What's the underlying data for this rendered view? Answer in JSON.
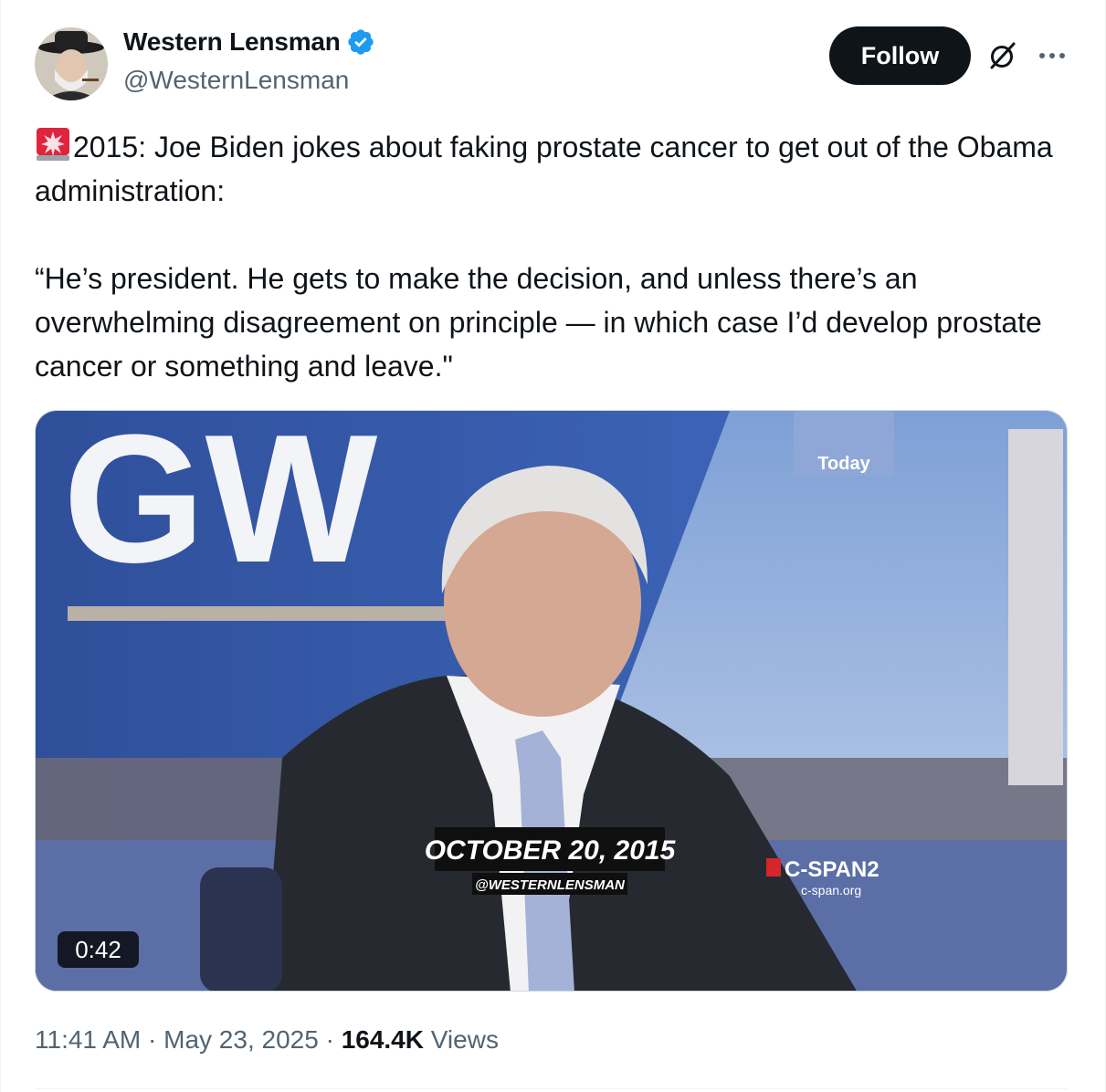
{
  "author": {
    "display_name": "Western Lensman",
    "handle": "@WesternLensman",
    "verified": true,
    "verified_color": "#1d9bf0"
  },
  "actions": {
    "follow_label": "Follow",
    "grok_icon": "grok-icon",
    "more_icon": "more-icon"
  },
  "tweet": {
    "emoji": "siren-emoji",
    "line1": "2015: Joe Biden jokes about faking prostate cancer to get out of the Obama administration:",
    "quote": "“He’s president. He gets to make the decision, and unless there’s an overwhelming disagreement on principle — in which case I’d develop prostate cancer or something and leave.\""
  },
  "video": {
    "duration": "0:42",
    "overlay_date": "OCTOBER 20, 2015",
    "overlay_handle": "@WESTERNLENSMAN",
    "backdrop_letters": "GW",
    "today_label": "Today",
    "network": "C-SPAN2",
    "network_url": "c-span.org"
  },
  "meta": {
    "time": "11:41 AM",
    "separator": " · ",
    "date": "May 23, 2025",
    "views_count": "164.4K",
    "views_label": "Views"
  }
}
